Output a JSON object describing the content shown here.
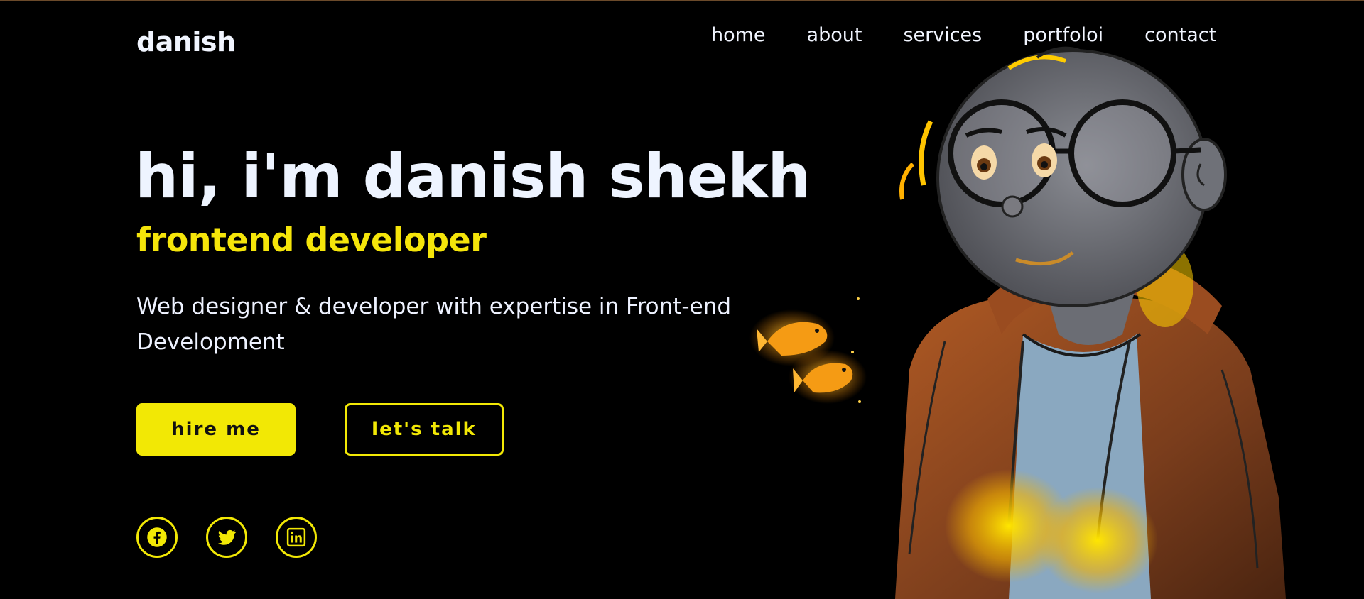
{
  "header": {
    "logo": "danish",
    "nav": [
      "home",
      "about",
      "services",
      "portfoloi",
      "contact"
    ]
  },
  "hero": {
    "title": "hi, i'm danish shekh",
    "subtitle": "frontend developer",
    "description": "Web designer & developer with expertise in Front-end Development",
    "buttons": {
      "hire": "hire me",
      "talk": "let's talk"
    }
  },
  "social": [
    "facebook-icon",
    "twitter-icon",
    "linkedin-icon"
  ],
  "colors": {
    "accent": "#f2e805",
    "background": "#000000",
    "text": "#eef2ff"
  }
}
